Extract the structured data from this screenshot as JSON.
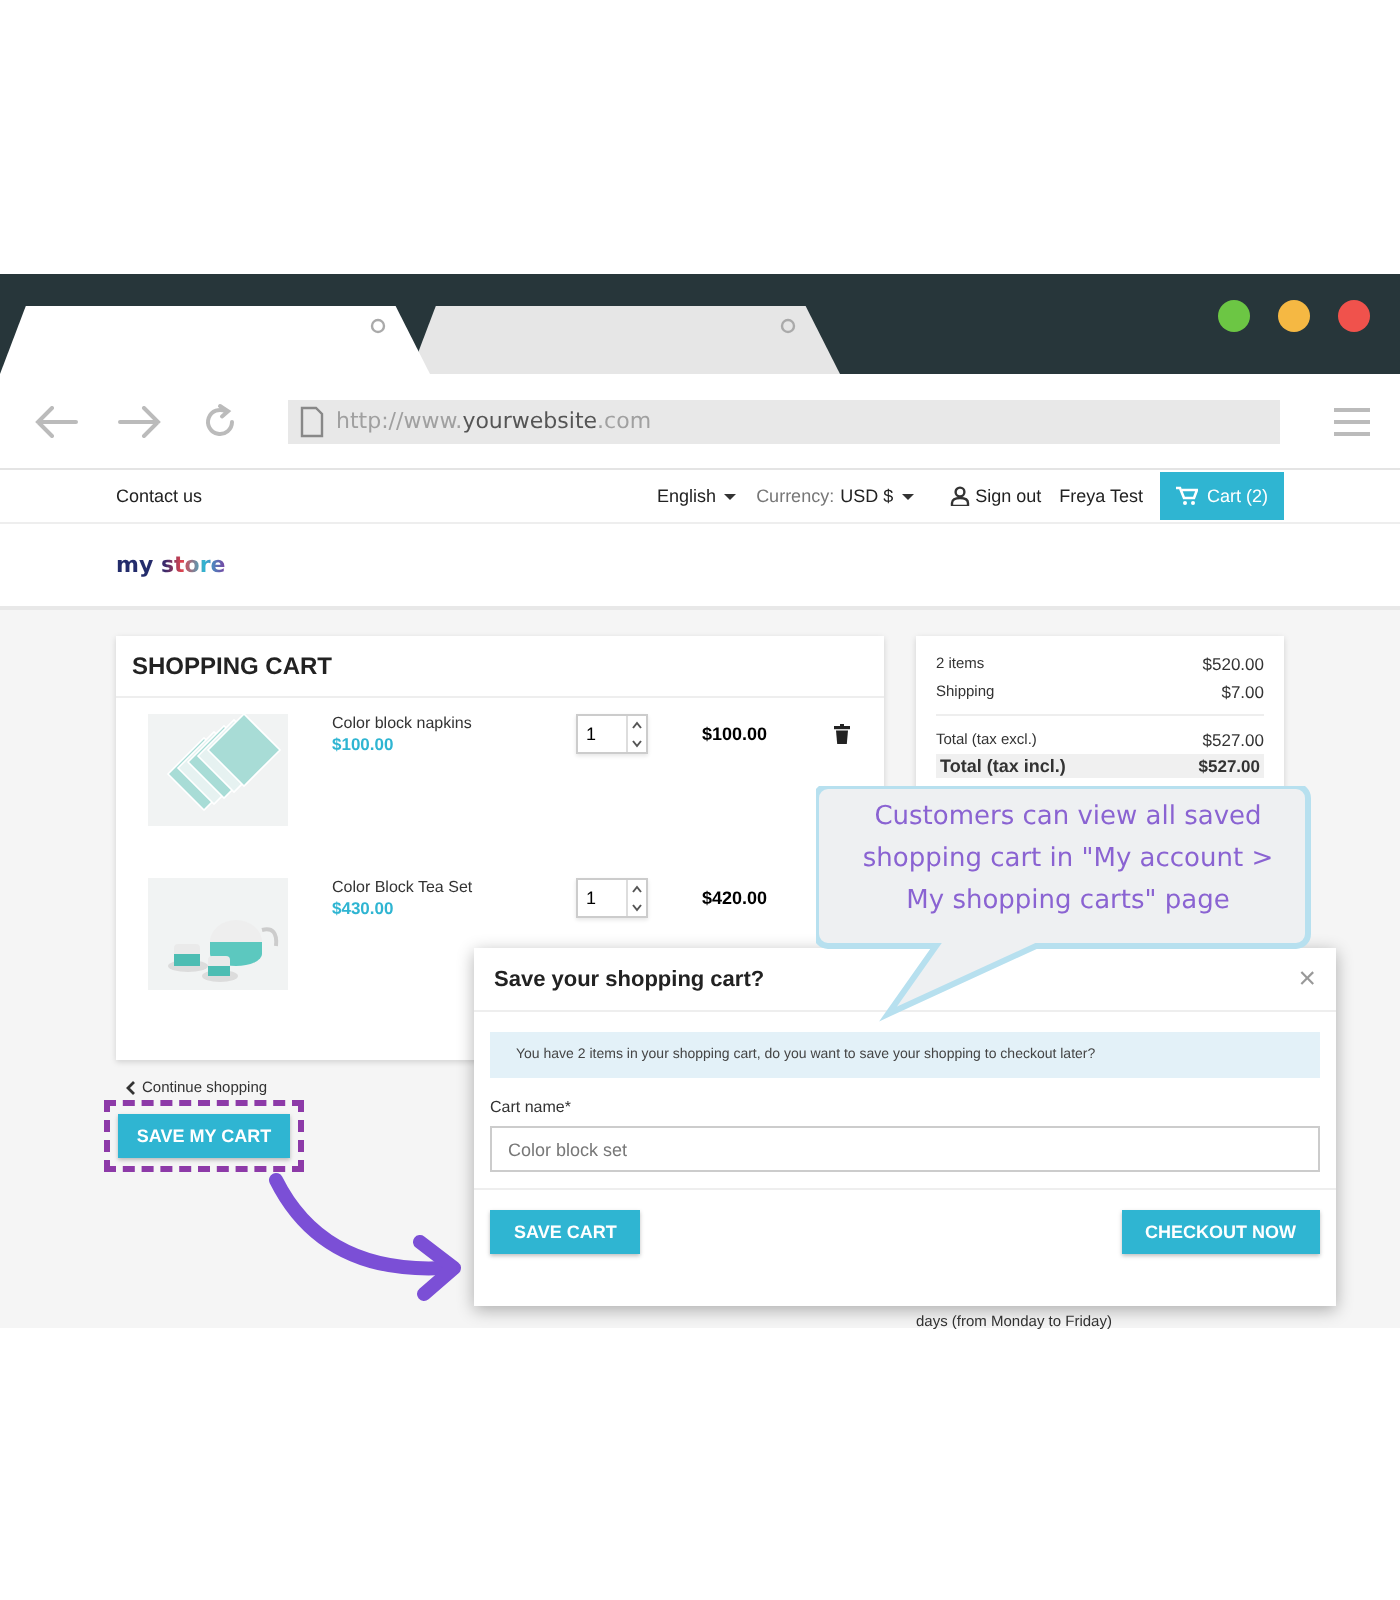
{
  "browser": {
    "tabs": [
      {
        "selected": true
      },
      {
        "selected": false
      }
    ],
    "url": "http://www.**yourwebsite**.com"
  },
  "nav": {
    "contact": "Contact us",
    "language": "English",
    "currency_label": "Currency:",
    "currency": "USD $",
    "sign_out": "Sign out",
    "user": "Freya Test",
    "cart": "Cart (2)"
  },
  "logo": "my store",
  "cart": {
    "title": "SHOPPING CART",
    "items": [
      {
        "name": "Color block napkins",
        "unit_price": "$100.00",
        "quantity": "1",
        "total": "$100.00",
        "kind": "napkins",
        "trash": true
      },
      {
        "name": "Color Block Tea Set",
        "unit_price": "$430.00",
        "quantity": "1",
        "total": "$420.00",
        "kind": "teaset"
      }
    ],
    "continue": "Continue shopping",
    "save_button": "SAVE MY CART"
  },
  "summary": {
    "lines": [
      {
        "label": "2 items",
        "value": "$520.00"
      },
      {
        "label": "Shipping",
        "value": "$7.00"
      }
    ],
    "totals": [
      {
        "label": "Total (tax excl.)",
        "value": "$527.00",
        "emphasis": false
      },
      {
        "label": "Total (tax incl.)",
        "value": "$527.00",
        "emphasis": true
      }
    ],
    "note": "days (from Monday to Friday)"
  },
  "callout": "Customers can view all saved shopping cart in \"My account > My shopping carts\" page",
  "modal": {
    "title": "Save your shopping cart?",
    "close": "×",
    "message": "You have 2 items in your shopping cart, do you want to save your shopping to checkout later?",
    "field_label": "Cart name*",
    "placeholder": "Color block set",
    "save_button": "SAVE CART",
    "checkout_button": "CHECKOUT NOW"
  }
}
